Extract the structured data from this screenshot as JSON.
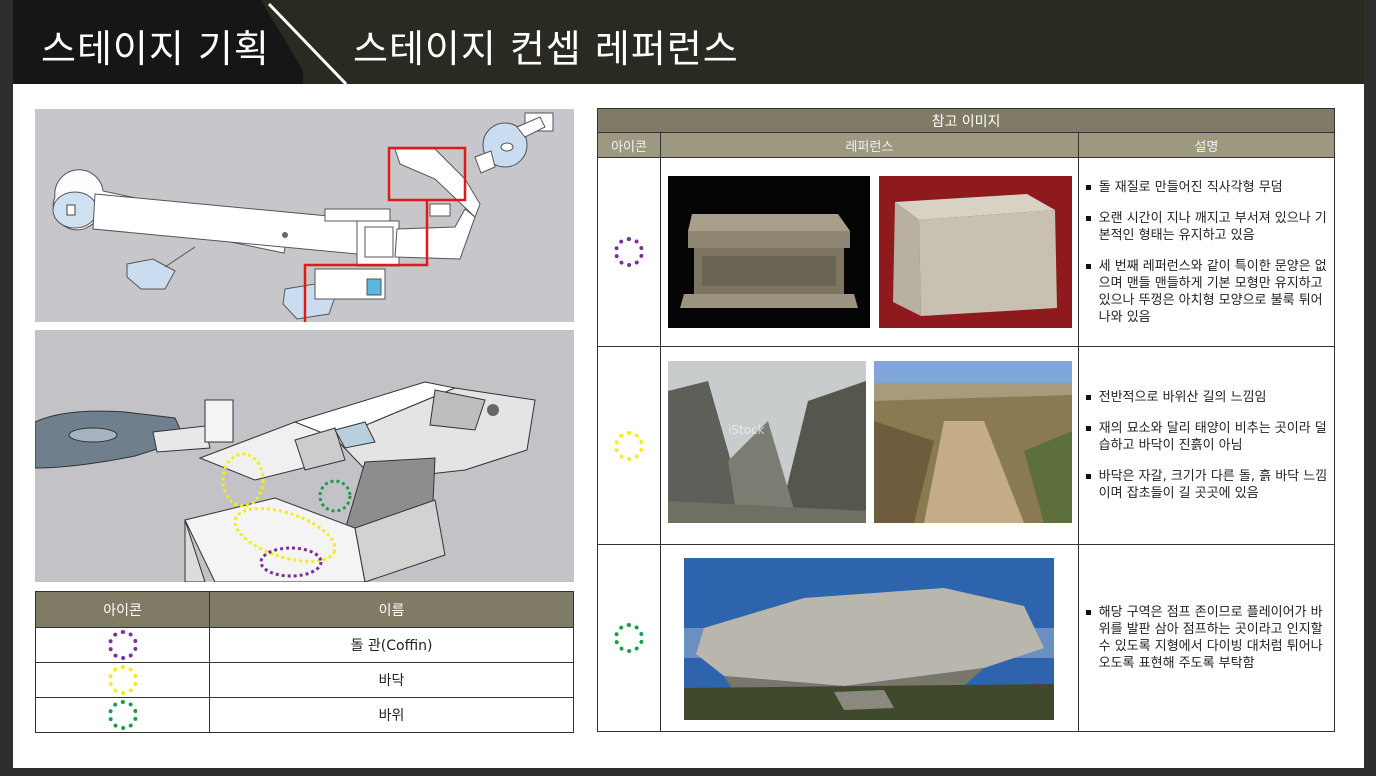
{
  "header": {
    "title": "스테이지 기획",
    "subtitle": "스테이지 컨셉 레퍼런스"
  },
  "colors": {
    "coffin": "#7a2f9c",
    "floor": "#f2ee1a",
    "rock": "#1f9a4a",
    "header_bg": "#2a2a22",
    "table_head": "#807b64"
  },
  "legend": {
    "headers": [
      "아이콘",
      "이름"
    ],
    "rows": [
      {
        "icon": "purple-dotted-circle",
        "name": "돌 관(Coffin)"
      },
      {
        "icon": "yellow-dotted-circle",
        "name": "바닥"
      },
      {
        "icon": "green-dotted-circle",
        "name": "바위"
      }
    ]
  },
  "reference": {
    "caption": "참고 이미지",
    "headers": [
      "아이콘",
      "레퍼런스",
      "설명"
    ],
    "rows": [
      {
        "icon": "purple-dotted-circle",
        "desc": [
          "돌 재질로 만들어진 직사각형 무덤",
          "오랜 시간이 지나 깨지고 부서져 있으나 기본적인 형태는 유지하고 있음",
          "세 번째 레퍼런스와 같이 특이한 문양은 없으며 맨들 맨들하게 기본 모형만 유지하고 있으나 뚜껑은 아치형 모양으로 불룩 튀어나와 있음"
        ]
      },
      {
        "icon": "yellow-dotted-circle",
        "desc": [
          "전반적으로 바위산 길의 느낌임",
          "재의 묘소와 달리 태양이 비추는 곳이라 덜 습하고 바닥이 진흙이 아님",
          "바닥은 자갈, 크기가 다른 돌, 흙 바닥 느낌이며 잡초들이 길 곳곳에 있음"
        ],
        "watermark": "iStock"
      },
      {
        "icon": "green-dotted-circle",
        "desc": [
          "해당 구역은 점프 존이므로 플레이어가 바위를 발판 삼아 점프하는 곳이라고 인지할 수 있도록 지형에서 다이빙 대처럼 튀어나오도록 표현해 주도록 부탁함"
        ]
      }
    ]
  }
}
